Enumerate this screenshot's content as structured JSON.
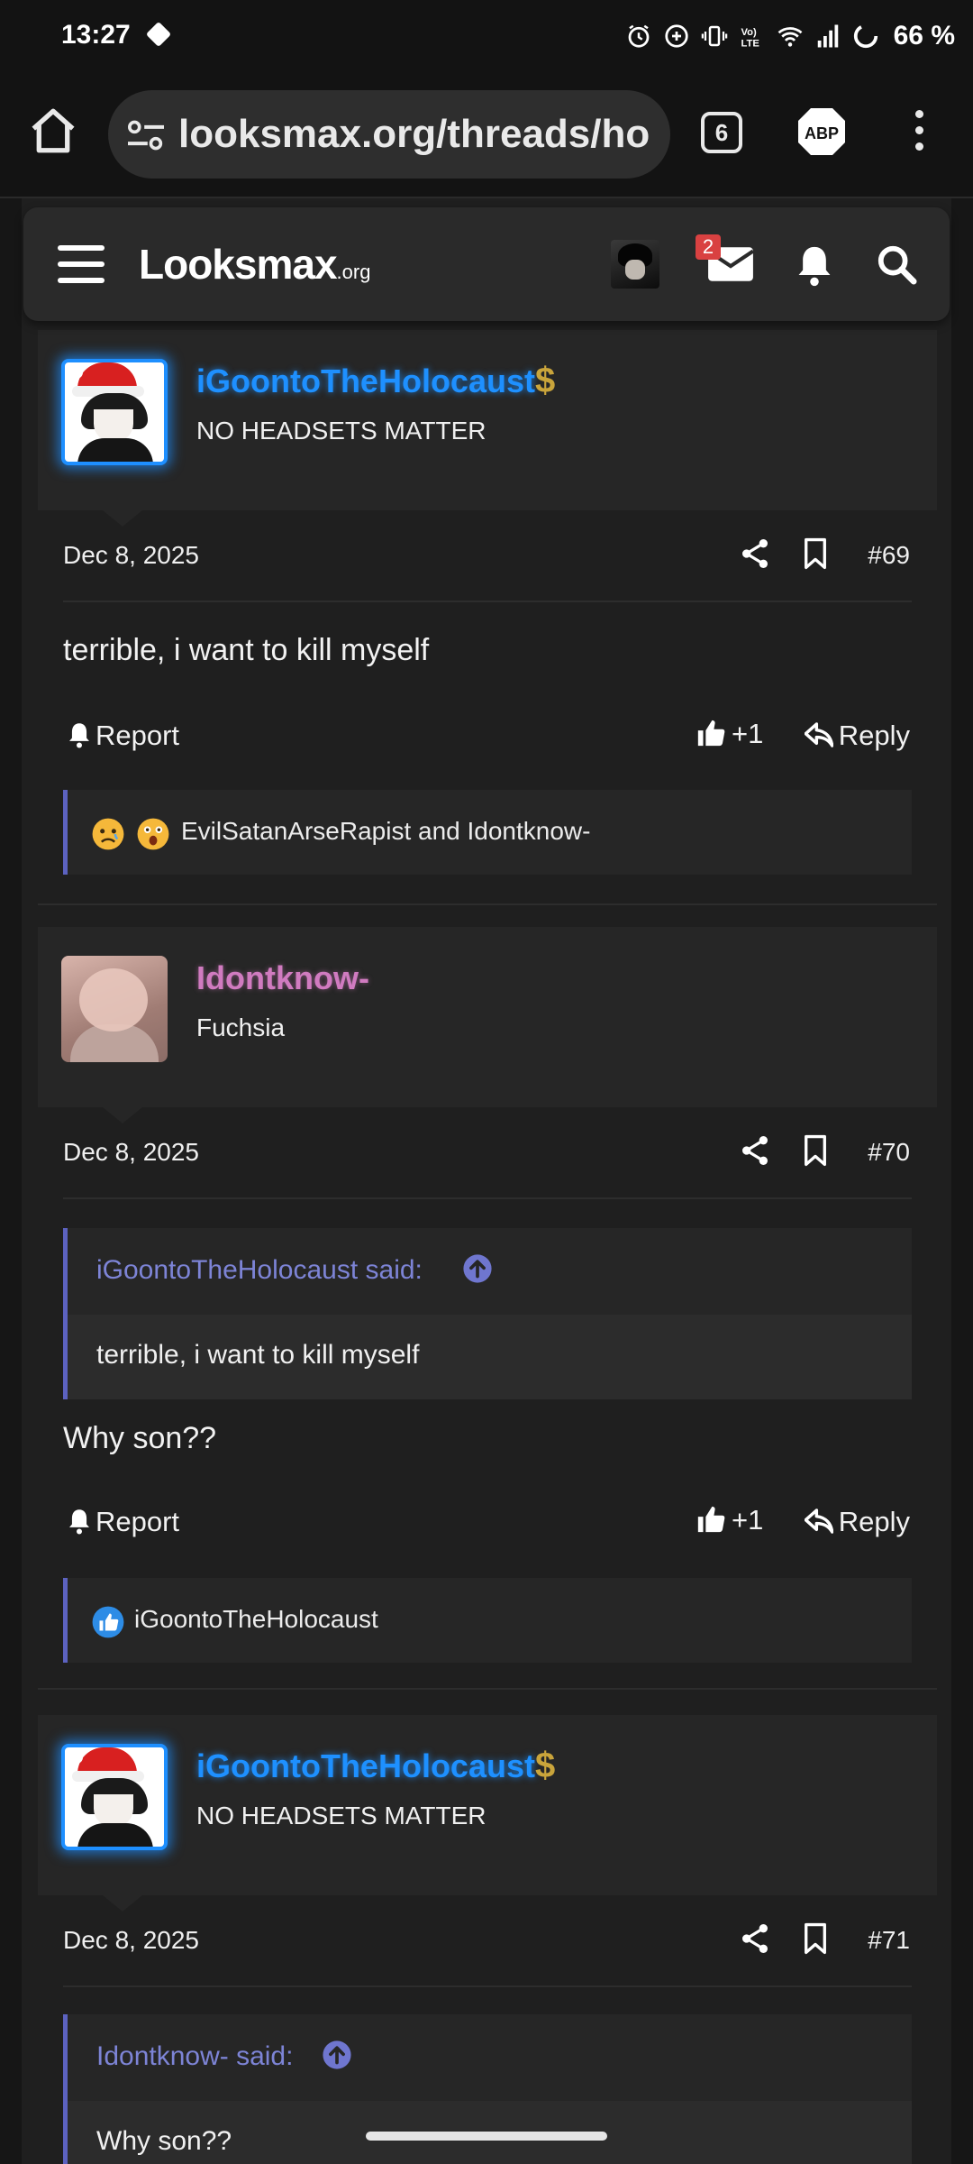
{
  "status_bar": {
    "time": "13:27",
    "battery": "66 %",
    "icons": [
      "alarm-icon",
      "add-circle-icon",
      "vibrate-icon",
      "volte-icon",
      "wifi-icon",
      "signal-icon",
      "battery-saver-icon"
    ]
  },
  "browser": {
    "url": "looksmax.org/threads/ho",
    "tab_count": "6",
    "adblock_label": "ABP"
  },
  "site_header": {
    "logo_main": "Lᴏᴏksmax",
    "logo_suffix": ".org",
    "notifications_badge": "2"
  },
  "posts": [
    {
      "username": "iGoontoTheHolocaust",
      "user_title": "NO HEADSETS MATTER",
      "badge": "$",
      "date": "Dec 8, 2025",
      "number": "#69",
      "body": "terrible, i want to kill myself",
      "report_label": "Report",
      "like_count": "+1",
      "reply_label": "Reply",
      "reactions_text": "EvilSatanArseRapist and Idontknow-"
    },
    {
      "username": "Idontknow-",
      "user_title": "Fuchsia",
      "date": "Dec 8, 2025",
      "number": "#70",
      "quote_author": "iGoontoTheHolocaust said:",
      "quote_text": "terrible, i want to kill myself",
      "body": "Why son??",
      "report_label": "Report",
      "like_count": "+1",
      "reply_label": "Reply",
      "reactions_text": "iGoontoTheHolocaust"
    },
    {
      "username": "iGoontoTheHolocaust",
      "user_title": "NO HEADSETS MATTER",
      "badge": "$",
      "date": "Dec 8, 2025",
      "number": "#71",
      "quote_author": "Idontknow- said:",
      "quote_text": "Why son??"
    }
  ],
  "colors": {
    "accent_quote": "#5c62c0",
    "username_blue": "#1e90ff",
    "username_pink": "#d07bc0",
    "badge_red": "#d94141"
  }
}
